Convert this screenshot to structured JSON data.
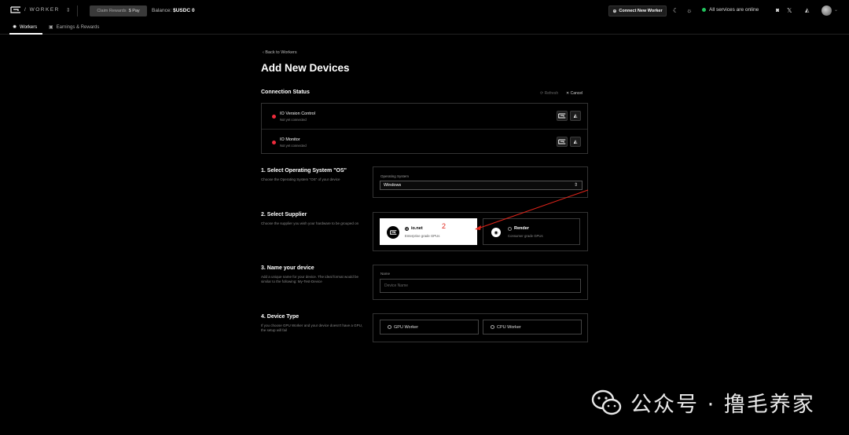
{
  "header": {
    "brand_text": "/ WORKER",
    "claim_label": "Claim Rewards",
    "claim_pay": "$ Pay",
    "balance_label": "Balance:",
    "balance_value": "$USDC 0",
    "connect_label": "Connect New Worker",
    "status_text": "All services are online"
  },
  "tabs": [
    {
      "label": "Workers",
      "active": true
    },
    {
      "label": "Earnings & Rewards",
      "active": false
    }
  ],
  "main": {
    "back_label": "Back to Workers",
    "title": "Add New Devices",
    "connection": {
      "title": "Connection Status",
      "refresh_label": "Refresh",
      "cancel_label": "Cancel",
      "items": [
        {
          "name": "IO Version Control",
          "status": "Not yet connected"
        },
        {
          "name": "IO Monitor",
          "status": "Not yet connected"
        }
      ]
    },
    "os": {
      "title": "1. Select Operating System \"OS\"",
      "desc": "Choose the Operating System \"OS\" of your device",
      "field_label": "Operating System",
      "selected": "Windows"
    },
    "supplier": {
      "title": "2. Select Supplier",
      "desc": "Choose the supplier you wish your hardware to be grouped on",
      "options": [
        {
          "name": "io.net",
          "sub": "Enterprise grade GPUs",
          "selected": true
        },
        {
          "name": "Render",
          "sub": "Consumer grade GPUs",
          "selected": false
        }
      ],
      "annotation": "2"
    },
    "device_name": {
      "title": "3. Name your device",
      "desc": "Add a unique name for your device. The ideal format would be similar to the following: My-Test-Device",
      "field_label": "Name",
      "placeholder": "Device Name"
    },
    "device_type": {
      "title": "4. Device Type",
      "desc": "If you choose GPU Worker and your device doesn't have a GPU, the setup will fail",
      "options": [
        {
          "label": "GPU Worker"
        },
        {
          "label": "CPU Worker"
        }
      ]
    }
  },
  "watermark": {
    "text": "公众号 · 撸毛养家"
  },
  "colors": {
    "background": "#000000",
    "status_online": "#22c55e",
    "not_connected": "#ef2b3c",
    "annotation": "#e0241a"
  }
}
